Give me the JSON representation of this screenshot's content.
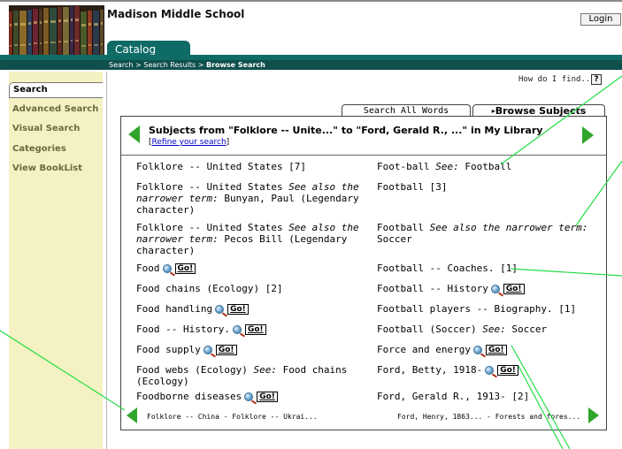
{
  "header": {
    "school_name": "Madison Middle School",
    "login_label": "Login",
    "catalog_tab": "Catalog",
    "breadcrumb": {
      "prefix": "Search > Search Results > ",
      "current": "Browse Search"
    }
  },
  "sidebar": {
    "current": "Search",
    "items": [
      "Advanced Search",
      "Visual Search",
      "Categories",
      "View BookList"
    ]
  },
  "help": {
    "how_do_i_find": "How do I find...",
    "question_mark": "?"
  },
  "tabs": {
    "search_all_words": "Search All Words",
    "browse_subjects": "Browse Subjects",
    "active_marker": "▸"
  },
  "panel": {
    "title": "Subjects from \"Folklore -- Unite...\" to \"Ford, Gerald R., ...\" in My Library",
    "refine_open": "[",
    "refine_link": "Refine your search",
    "refine_close": "]",
    "go_label": "Go!",
    "left_column": [
      {
        "lines": [
          "Folklore -- United States [7]"
        ]
      },
      {
        "lines": [
          "Folklore -- United States |See also the|",
          "|narrower term:| Bunyan, Paul (Legendary",
          "character)"
        ]
      },
      {
        "lines": [
          "Folklore -- United States |See also the|",
          "|narrower term:| Pecos Bill (Legendary",
          "character)"
        ]
      },
      {
        "lines": [
          "Food"
        ],
        "go": true
      },
      {
        "lines": [
          "Food chains (Ecology) [2]"
        ]
      },
      {
        "lines": [
          "Food handling"
        ],
        "go": true
      },
      {
        "lines": [
          "Food -- History."
        ],
        "go": true
      },
      {
        "lines": [
          "Food supply"
        ],
        "go": true
      },
      {
        "lines": [
          "Food webs (Ecology) |See:| Food chains",
          "(Ecology)"
        ]
      },
      {
        "lines": [
          "Foodborne diseases"
        ],
        "go": true
      }
    ],
    "right_column": [
      {
        "lines": [
          "Foot-ball |See:| Football"
        ]
      },
      {
        "lines": [
          "Football [3]"
        ]
      },
      {
        "lines": [
          "Football |See also the narrower term:|",
          "Soccer"
        ]
      },
      {
        "lines": [
          "Football -- Coaches. [1]"
        ]
      },
      {
        "lines": [
          "Football -- History"
        ],
        "go": true
      },
      {
        "lines": [
          "Football players -- Biography. [1]"
        ]
      },
      {
        "lines": [
          "Football (Soccer) |See:| Soccer"
        ]
      },
      {
        "lines": [
          "Force and energy"
        ],
        "go": true
      },
      {
        "lines": [
          "Ford, Betty, 1918-"
        ],
        "go": true
      },
      {
        "lines": [
          "Ford, Gerald R., 1913- [2]"
        ]
      }
    ],
    "prev_range": "Folklore -- China - Folklore -- Ukrai...",
    "next_range": "Ford, Henry, 1863... - Forests and fores..."
  },
  "colors": {
    "catalog_green": "#0f6b66",
    "breadcrumb_bar": "#0f4f4c",
    "sidebar_bg": "#f4f2c2",
    "sidebar_text": "#6b6b3e",
    "arrow_green": "#2fa52c",
    "callout_line": "#22dd44",
    "link_blue": "#0000cc"
  },
  "icons": {
    "arrow_prev": "green-left-triangle",
    "arrow_next": "green-right-triangle",
    "go": "globe-magnifier-go"
  }
}
